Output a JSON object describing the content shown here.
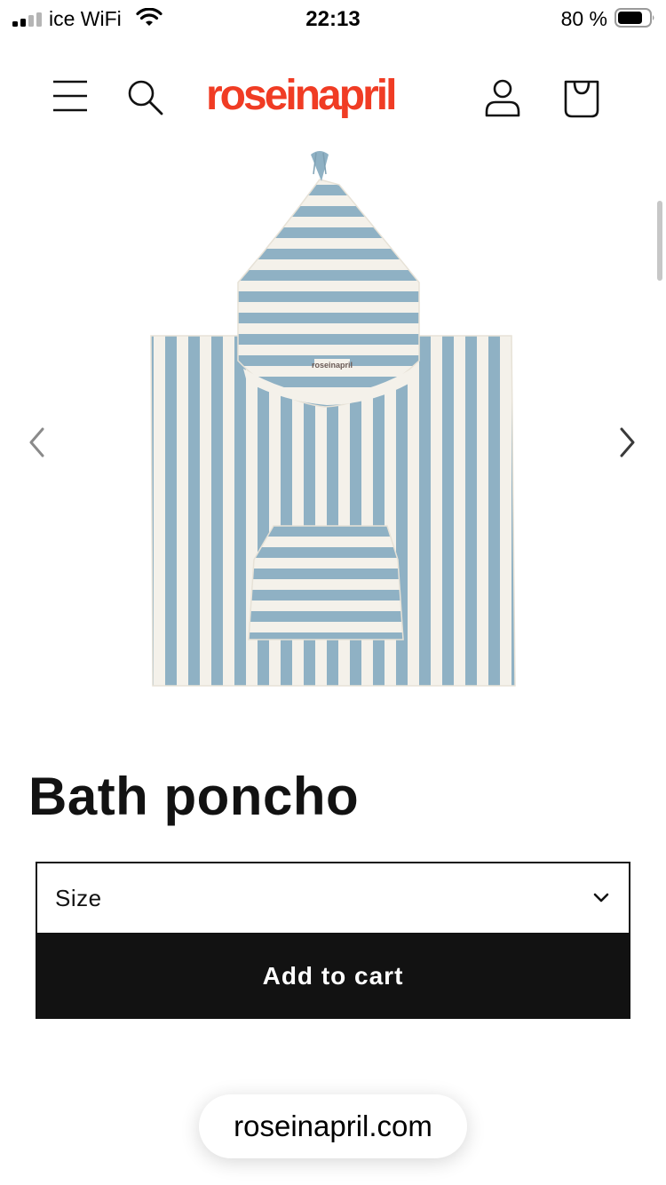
{
  "status_bar": {
    "carrier": "ice WiFi",
    "time": "22:13",
    "battery_percent": "80 %",
    "icons": [
      "signal-icon",
      "wifi-icon",
      "battery-icon"
    ]
  },
  "header": {
    "logo_text": "roseinapril",
    "icons": [
      "menu-icon",
      "search-icon",
      "account-icon",
      "cart-icon"
    ]
  },
  "gallery": {
    "nav_icons": [
      "chevron-left-icon",
      "chevron-right-icon"
    ],
    "image_label": "roseinapril"
  },
  "product": {
    "title": "Bath poncho",
    "size_select": {
      "label": "Size",
      "icon": "chevron-down-icon"
    },
    "add_to_cart_label": "Add to cart"
  },
  "browser": {
    "url": "roseinapril.com"
  },
  "colors": {
    "brand": "#f03c24",
    "text": "#121212",
    "button_bg": "#121212",
    "stripe_blue": "#8fb1c4",
    "stripe_cream": "#f4f1ea"
  }
}
